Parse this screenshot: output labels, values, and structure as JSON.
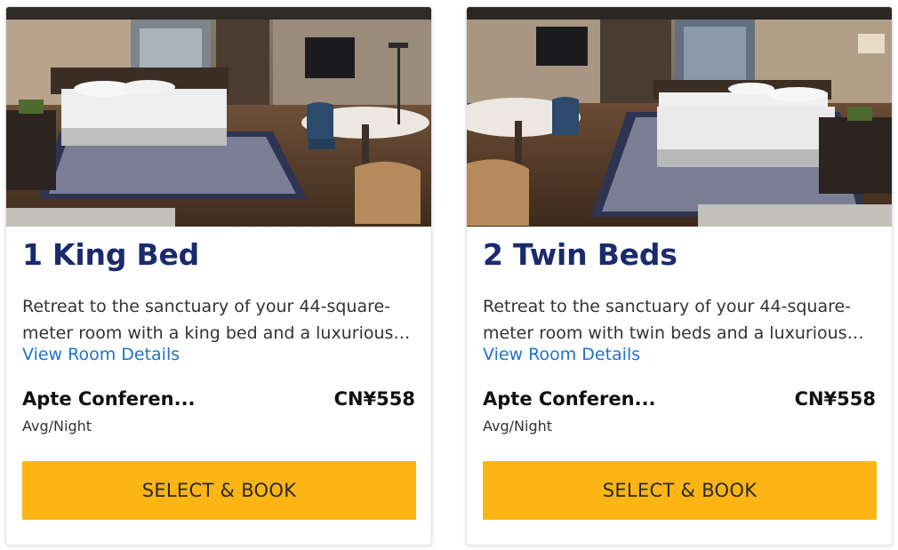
{
  "rooms": [
    {
      "title": "1 King Bed",
      "description": "Retreat to the sanctuary of your 44-square-meter room with a king bed and a luxurious bathroom.",
      "details_link": "View Room Details",
      "rate_name": "Apte Conferen...",
      "price": "CN¥558",
      "price_unit": "Avg/Night",
      "button_label": "SELECT & BOOK"
    },
    {
      "title": "2 Twin Beds",
      "description": "Retreat to the sanctuary of your 44-square-meter room with twin beds and a luxurious bathroom.",
      "details_link": "View Room Details",
      "rate_name": "Apte Conferen...",
      "price": "CN¥558",
      "price_unit": "Avg/Night",
      "button_label": "SELECT & BOOK"
    }
  ],
  "colors": {
    "title": "#1a2b6d",
    "link": "#1f73c9",
    "button": "#fdb515"
  }
}
